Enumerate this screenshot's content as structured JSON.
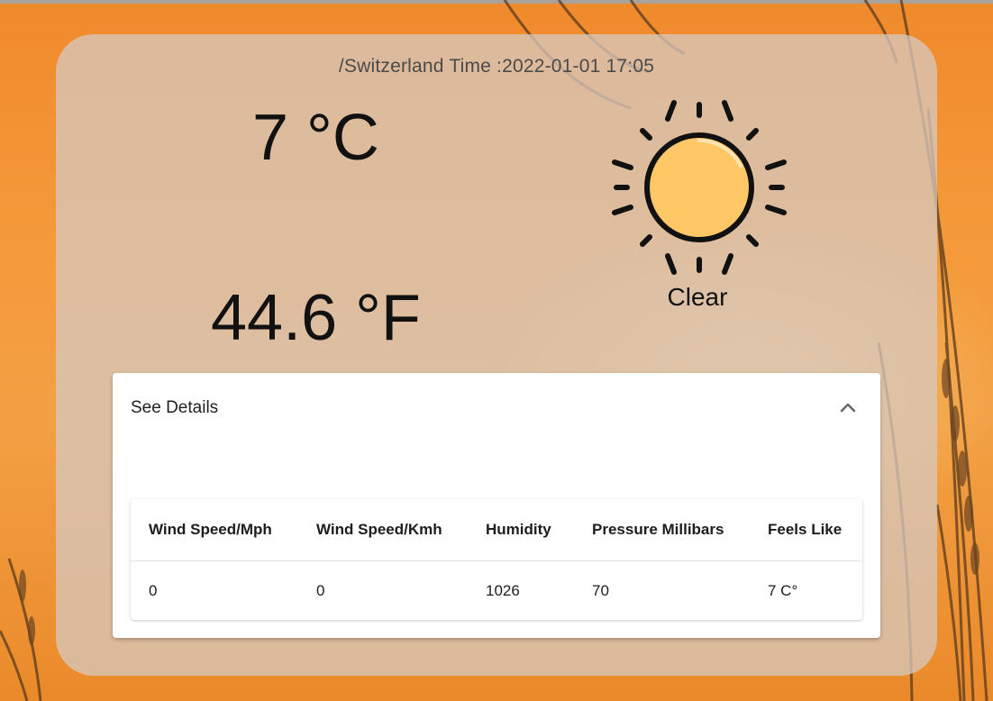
{
  "weather": {
    "location_time": "/Switzerland Time :2022-01-01 17:05",
    "temp_c": "7 °C",
    "temp_f": "44.6 °F",
    "condition": "Clear",
    "condition_icon": "sun-icon"
  },
  "details": {
    "title": "See Details",
    "expanded": true,
    "toggle_icon": "chevron-up-icon",
    "columns": [
      "Wind Speed/Mph",
      "Wind Speed/Kmh",
      "Humidity",
      "Pressure Millibars",
      "Feels Like"
    ],
    "rows": [
      [
        "0",
        "0",
        "1026",
        "70",
        "7 C°"
      ]
    ]
  },
  "colors": {
    "background": "#f39a3a",
    "card": "#d6c8be",
    "sun_fill": "#ffc766",
    "sun_stroke": "#111111"
  }
}
